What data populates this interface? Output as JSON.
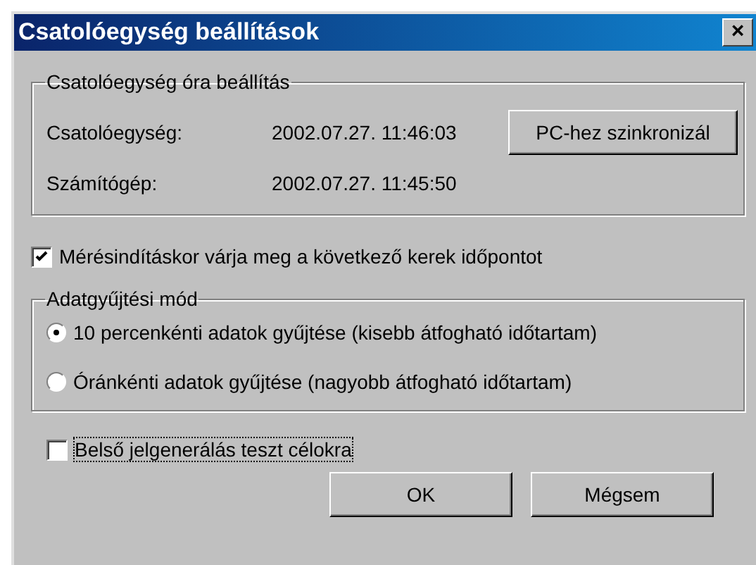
{
  "window": {
    "title": "Csatolóegység beállítások",
    "close": "×"
  },
  "clock_group": {
    "legend": "Csatolóegység óra beállítás",
    "rows": [
      {
        "label": "Csatolóegység:",
        "value": "2002.07.27. 11:46:03"
      },
      {
        "label": "Számítógép:",
        "value": "2002.07.27. 11:45:50"
      }
    ],
    "sync_button": "PC-hez szinkronizál"
  },
  "wait_checkbox": {
    "label": "Mérésindításkor várja meg a következő kerek időpontot",
    "checked": true,
    "focused": false
  },
  "mode_group": {
    "legend": "Adatgyűjtési mód",
    "options": [
      {
        "label": "10 percenkénti adatok gyűjtése (kisebb átfogható időtartam)",
        "selected": true
      },
      {
        "label": "Óránkénti adatok gyűjtése (nagyobb átfogható időtartam)",
        "selected": false
      }
    ]
  },
  "test_checkbox": {
    "label": "Belső jelgenerálás teszt célokra",
    "checked": false,
    "focused": true
  },
  "buttons": [
    "OK",
    "Mégsem"
  ]
}
